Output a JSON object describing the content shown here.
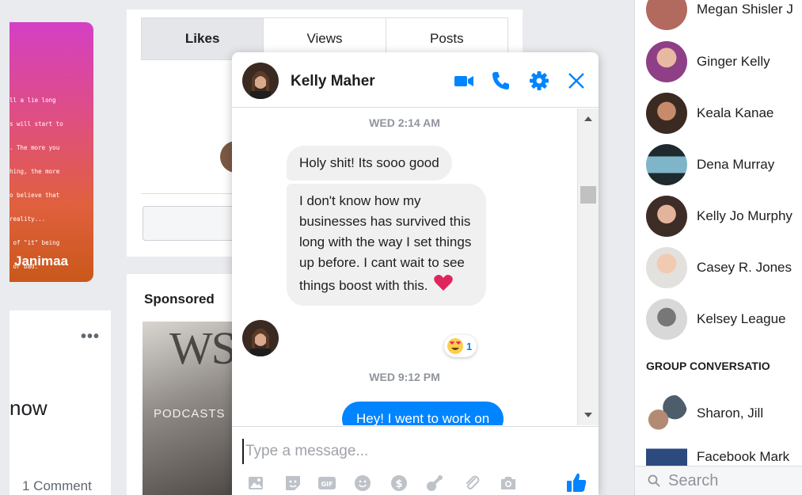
{
  "story": {
    "text_lines": [
      "ll a lie long",
      "s will start to",
      ". The more you",
      "hing, the more",
      "o believe that",
      "reality...",
      " of \"it\" being",
      " or bad."
    ],
    "name": "Janimaa"
  },
  "post": {
    "more_label": "•••",
    "partial_text": "now",
    "comment_count": "1 Comment"
  },
  "tabs": [
    {
      "label": "Likes"
    },
    {
      "label": "Views"
    },
    {
      "label": "Posts"
    }
  ],
  "sponsored": {
    "label": "Sponsored",
    "image_text_main": "WSJ",
    "image_text_sub": "PODCASTS"
  },
  "chat": {
    "contact_name": "Kelly Maher",
    "timestamp_1": "WED 2:14 AM",
    "message_1": "Holy shit! Its sooo good",
    "message_2": "I don't know how my businesses has survived this long with the way I set things up before. I cant wait to see things boost with this.",
    "reaction_count": "1",
    "timestamp_2": "WED 9:12 PM",
    "message_3": "Hey! I went to work on",
    "composer_placeholder": "Type a message...",
    "accent_color": "#0084ff",
    "header_icons": [
      "video-call-icon",
      "phone-icon",
      "settings-gear-icon",
      "close-icon"
    ],
    "toolbar_icons": [
      "photo-icon",
      "sticker-icon",
      "gif-icon",
      "emoji-icon",
      "payment-dollar-icon",
      "games-icon",
      "attachment-paperclip-icon",
      "camera-icon",
      "like-thumb-icon"
    ],
    "toolbar_gif_label": "GIF"
  },
  "sidebar": {
    "contacts": [
      {
        "name": "Megan Shisler J"
      },
      {
        "name": "Ginger Kelly"
      },
      {
        "name": "Keala Kanae"
      },
      {
        "name": "Dena Murray"
      },
      {
        "name": "Kelly Jo Murphy"
      },
      {
        "name": "Casey R. Jones"
      },
      {
        "name": "Kelsey League"
      }
    ],
    "group_heading": "GROUP CONVERSATIO",
    "groups": [
      {
        "name": "Sharon, Jill"
      },
      {
        "name": "Facebook Mark"
      }
    ],
    "search_placeholder": "Search"
  }
}
